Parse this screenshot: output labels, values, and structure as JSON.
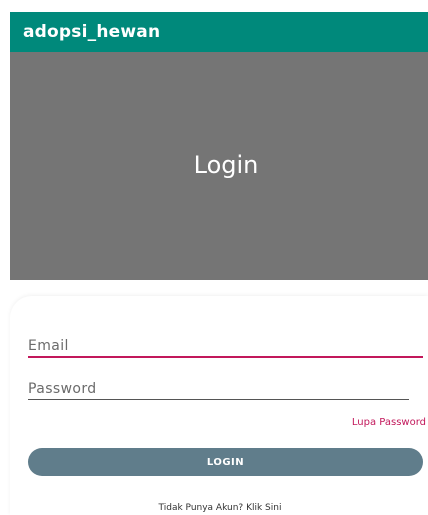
{
  "app_bar": {
    "title": "adopsi_hewan"
  },
  "header": {
    "title": "Login"
  },
  "form": {
    "email_label": "Email",
    "password_label": "Password",
    "forgot_password": "Lupa Password",
    "login_button": "LOGIN",
    "signup_link": "Tidak Punya Akun? Klik Sini"
  },
  "colors": {
    "app_bar": "#00897b",
    "header_bg": "#757575",
    "accent": "#c2185b",
    "button": "#607d8b"
  }
}
